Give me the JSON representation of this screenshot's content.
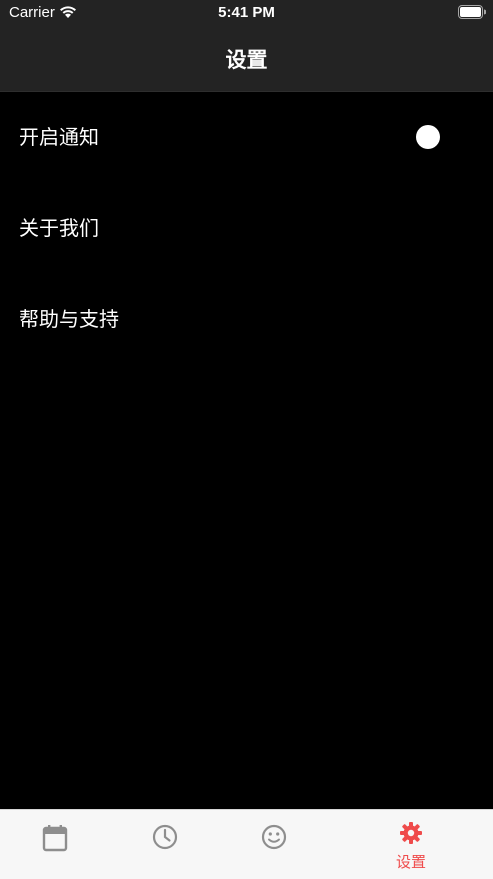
{
  "status_bar": {
    "carrier": "Carrier",
    "time": "5:41 PM",
    "wifi_icon": "wifi-icon",
    "battery_icon": "battery-icon"
  },
  "nav": {
    "title": "设置"
  },
  "settings": {
    "items": [
      {
        "label": "开启通知",
        "has_toggle": true,
        "toggle_on": false
      },
      {
        "label": "关于我们"
      },
      {
        "label": "帮助与支持"
      }
    ]
  },
  "tab_bar": {
    "tabs": [
      {
        "icon": "calendar-icon",
        "label": ""
      },
      {
        "icon": "clock-icon",
        "label": ""
      },
      {
        "icon": "smiley-icon",
        "label": ""
      },
      {
        "icon": "gear-icon",
        "label": "设置",
        "selected": true
      }
    ],
    "active_color": "#ef4b4b",
    "inactive_color": "#8e8e8e"
  },
  "colors": {
    "background": "#000000",
    "nav_background": "#232323",
    "tab_bar_background": "#f7f7f7"
  }
}
